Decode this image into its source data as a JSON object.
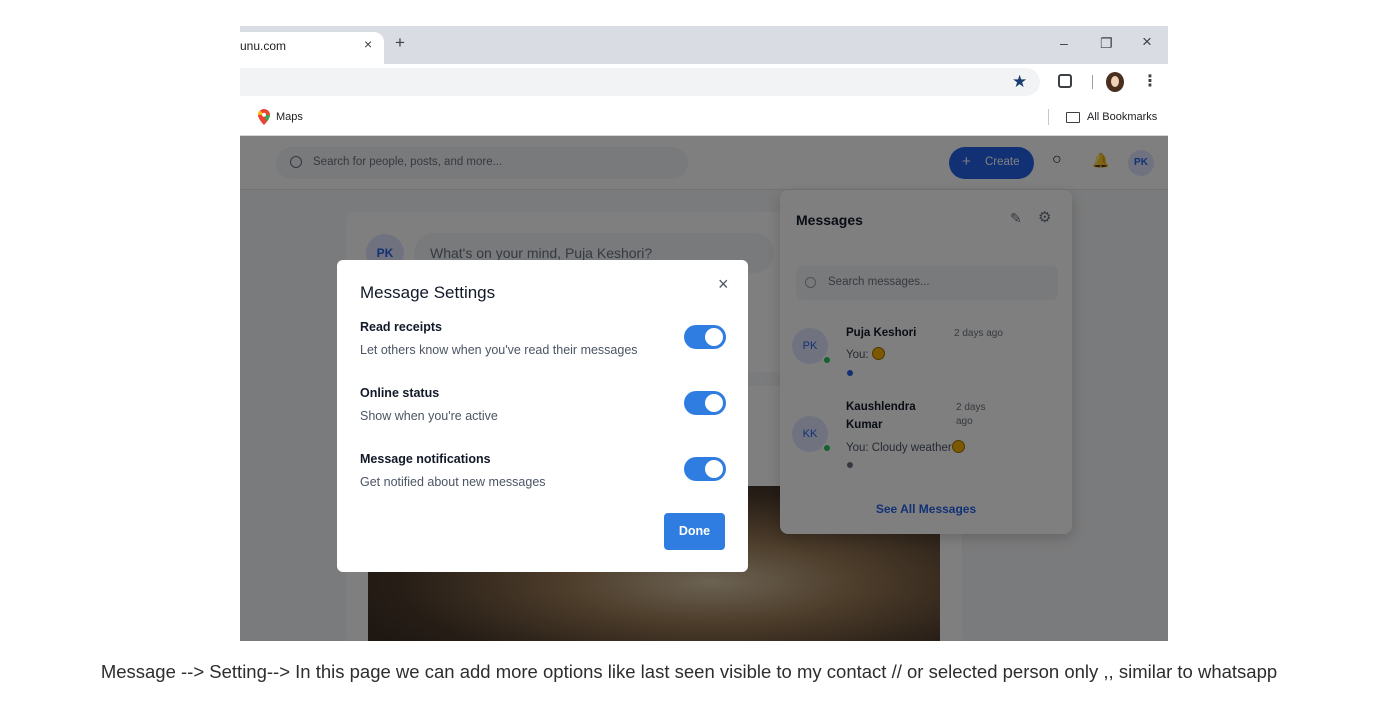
{
  "browser": {
    "tab_title": "unu.com",
    "tab_close": "×",
    "new_tab": "+",
    "minimize": "–",
    "restore": "❐",
    "close": "×",
    "star_icon": "★",
    "kebab": "⋮",
    "bookmarks": {
      "maps": "Maps",
      "all_bookmarks": "All Bookmarks"
    }
  },
  "app": {
    "search_placeholder": "Search for people, posts, and more...",
    "create_plus": "+",
    "create_label": "Create",
    "chat_icon": "○",
    "bell_icon": "🔔",
    "user_initials": "PK",
    "composer": {
      "initials": "PK",
      "placeholder": "What's on your mind, Puja Keshori?"
    }
  },
  "messages_panel": {
    "title": "Messages",
    "edit_icon": "✎",
    "gear_icon": "⚙",
    "search_placeholder": "Search messages...",
    "conversations": [
      {
        "initials": "PK",
        "name": "Puja Keshori",
        "time": "2 days ago",
        "preview": "You:",
        "unread": true
      },
      {
        "initials": "KK",
        "name_line1": "Kaushlendra",
        "name_line2": "Kumar",
        "time_line1": "2 days",
        "time_line2": "ago",
        "preview": "You: Cloudy weather",
        "unread": false
      }
    ],
    "see_all": "See All Messages"
  },
  "modal": {
    "title": "Message Settings",
    "close": "×",
    "settings": [
      {
        "label": "Read receipts",
        "description": "Let others know when you've read their messages",
        "enabled": true
      },
      {
        "label": "Online status",
        "description": "Show when you're active",
        "enabled": true
      },
      {
        "label": "Message notifications",
        "description": "Get notified about new messages",
        "enabled": true
      }
    ],
    "done": "Done"
  },
  "caption": "Message --> Setting--> In this page we can add more options like last seen visible to my contact // or selected person only ,, similar to whatsapp",
  "colors": {
    "accent": "#2f7de1",
    "primary": "#2563eb",
    "online": "#22c55e"
  }
}
